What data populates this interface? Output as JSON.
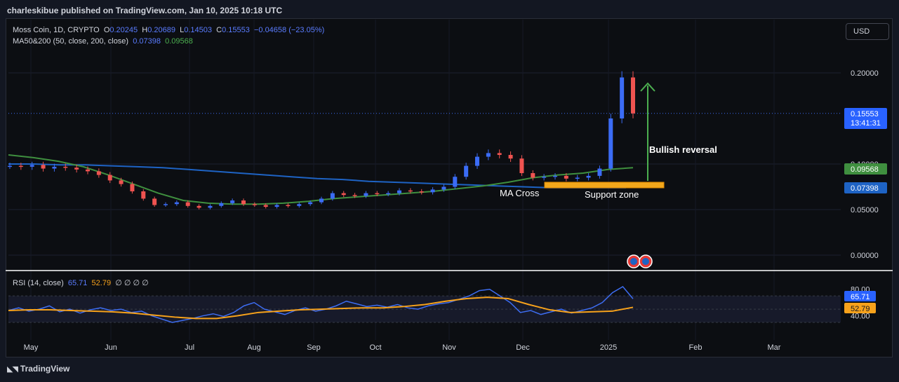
{
  "header": {
    "publisher_line": "charleskibue published on TradingView.com, Jan 10, 2025 10:18 UTC"
  },
  "symbol_info": {
    "name": "Moss Coin, 1D, CRYPTO",
    "o_label": "O",
    "o_value": "0.20245",
    "h_label": "H",
    "h_value": "0.20689",
    "l_label": "L",
    "l_value": "0.14503",
    "c_label": "C",
    "c_value": "0.15553",
    "change": "−0.04658 (−23.05%)"
  },
  "ma_info": {
    "label": "MA50&200 (50, close, 200, close)",
    "ma50": "0.07398",
    "ma200": "0.09568"
  },
  "rsi_info": {
    "label": "RSI (14, close)",
    "rsi": "65.71",
    "rsi_ma": "52.79",
    "extras": "∅ ∅ ∅ ∅"
  },
  "toolbar": {
    "currency": "USD"
  },
  "footer": {
    "brand": "TradingView"
  },
  "colors": {
    "up": "#3b6cf6",
    "down": "#ef5350",
    "ma200": "#1e63c4",
    "ma50": "#3f8f3f",
    "rsi": "#3d6df2",
    "rsi_ma": "#f7a21b",
    "support": "#f2a71b",
    "arrow": "#4caf50"
  },
  "chart_data": {
    "type": "candlestick",
    "price_axis": {
      "min": 0.0,
      "max": 0.2,
      "ticks": [
        "0.20000",
        "0.10000",
        "0.05000",
        "0.00000"
      ]
    },
    "last_price": {
      "value": "0.15553",
      "countdown": "13:41:31"
    },
    "ma_labels": {
      "ma50": "0.09568",
      "ma200": "0.07398"
    },
    "x_labels": [
      "May",
      "Jun",
      "Jul",
      "Aug",
      "Sep",
      "Oct",
      "Nov",
      "Dec",
      "2025",
      "Feb",
      "Mar"
    ],
    "close_series": [
      0.098,
      0.097,
      0.099,
      0.095,
      0.097,
      0.096,
      0.094,
      0.092,
      0.088,
      0.082,
      0.078,
      0.07,
      0.062,
      0.055,
      0.056,
      0.058,
      0.054,
      0.052,
      0.054,
      0.057,
      0.06,
      0.056,
      0.055,
      0.053,
      0.055,
      0.054,
      0.056,
      0.058,
      0.062,
      0.068,
      0.066,
      0.065,
      0.068,
      0.067,
      0.068,
      0.071,
      0.07,
      0.069,
      0.072,
      0.075,
      0.086,
      0.098,
      0.108,
      0.112,
      0.11,
      0.106,
      0.09,
      0.085,
      0.086,
      0.087,
      0.084,
      0.085,
      0.087,
      0.095,
      0.15,
      0.195,
      0.15553
    ],
    "ma200_values": [
      0.1,
      0.1,
      0.099,
      0.099,
      0.098,
      0.097,
      0.096,
      0.094,
      0.092,
      0.09,
      0.088,
      0.086,
      0.084,
      0.083,
      0.081,
      0.08,
      0.079,
      0.078,
      0.077,
      0.076,
      0.075,
      0.074,
      0.074,
      0.074,
      0.074
    ],
    "ma50_values": [
      0.11,
      0.107,
      0.103,
      0.097,
      0.088,
      0.078,
      0.068,
      0.06,
      0.057,
      0.056,
      0.056,
      0.057,
      0.059,
      0.062,
      0.064,
      0.066,
      0.068,
      0.07,
      0.073,
      0.076,
      0.08,
      0.085,
      0.088,
      0.09,
      0.094,
      0.096
    ],
    "annotations": {
      "bullish": "Bullish reversal",
      "ma_cross": "MA Cross",
      "support": "Support zone"
    },
    "rsi": {
      "ticks": [
        "80.00",
        "40.00"
      ],
      "last_rsi": "65.71",
      "last_rsi_ma": "52.79",
      "rsi_values": [
        48,
        52,
        47,
        50,
        55,
        46,
        50,
        44,
        49,
        52,
        48,
        50,
        45,
        47,
        40,
        35,
        30,
        33,
        36,
        40,
        43,
        39,
        45,
        55,
        60,
        50,
        46,
        42,
        48,
        52,
        47,
        50,
        55,
        62,
        58,
        54,
        56,
        53,
        57,
        52,
        50,
        55,
        58,
        60,
        65,
        70,
        78,
        80,
        70,
        60,
        45,
        48,
        42,
        46,
        50,
        44,
        48,
        52,
        60,
        75,
        84,
        65.71
      ],
      "rsi_ma_values": [
        48,
        49,
        49,
        48,
        47,
        46,
        44,
        41,
        38,
        36,
        36,
        40,
        45,
        47,
        49,
        50,
        51,
        52,
        52,
        54,
        57,
        62,
        66,
        68,
        66,
        57,
        49,
        45,
        46,
        47,
        52.79
      ]
    }
  }
}
